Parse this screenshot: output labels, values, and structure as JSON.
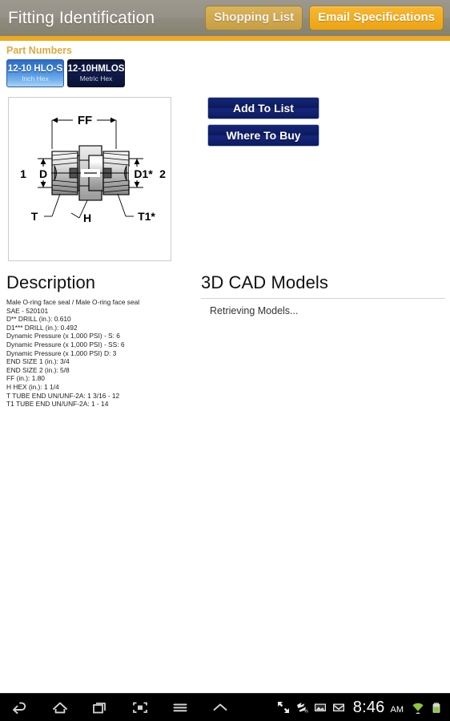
{
  "header": {
    "title": "Fitting Identification",
    "shopping_list_label": "Shopping List",
    "email_specs_label": "Email Specifications",
    "accent_color": "#f0a81c",
    "bar_color": "#969287"
  },
  "part_numbers": {
    "label": "Part Numbers",
    "tabs": [
      {
        "code": "12-10 HLO-S",
        "sub": "Inch Hex",
        "selected": true
      },
      {
        "code": "12-10HMLOS",
        "sub": "Metric Hex",
        "selected": false
      }
    ]
  },
  "diagram": {
    "alt": "straight-fitting-drawing",
    "labels": {
      "ff": "FF",
      "left_num": "1",
      "right_num": "2",
      "d": "D",
      "d1": "D1*",
      "t": "T",
      "t1": "T1*",
      "h": "H"
    }
  },
  "actions": {
    "add_to_list_label": "Add To List",
    "where_to_buy_label": "Where To Buy",
    "button_color": "#0d1b60"
  },
  "description": {
    "heading": "Description",
    "lines": [
      "Male O-ring face seal / Male O-ring face seal",
      "SAE - 520101",
      "D** DRILL (in.): 0.610",
      "D1*** DRILL (in.): 0.492",
      "Dynamic Pressure (x 1,000 PSI) - S: 6",
      "Dynamic Pressure (x 1,000 PSI) - SS: 6",
      "Dynamic Pressure (x 1,000 PSI) D: 3",
      "END SIZE 1 (in.): 3/4",
      "END SIZE 2 (in.): 5/8",
      "FF (in.): 1.80",
      "H HEX (in.): 1 1/4",
      "T TUBE END UN/UNF-2A: 1 3/16 - 12",
      "T1 TUBE END UN/UNF-2A: 1 - 14"
    ]
  },
  "cad": {
    "heading": "3D CAD Models",
    "status": "Retrieving Models..."
  },
  "system_bar": {
    "nav": [
      {
        "name": "back",
        "glyph": "back-icon"
      },
      {
        "name": "home",
        "glyph": "home-icon"
      },
      {
        "name": "recents",
        "glyph": "recents-icon"
      },
      {
        "name": "screenshot",
        "glyph": "screenshot-icon"
      },
      {
        "name": "menu",
        "glyph": "menu-icon"
      },
      {
        "name": "expand",
        "glyph": "chevron-up-icon"
      }
    ],
    "clock": "8:46",
    "ampm": "AM",
    "status_icons": [
      "fullscreen-icon",
      "sync-icon",
      "image-icon",
      "mail-icon",
      "wifi-icon",
      "battery-icon"
    ]
  }
}
